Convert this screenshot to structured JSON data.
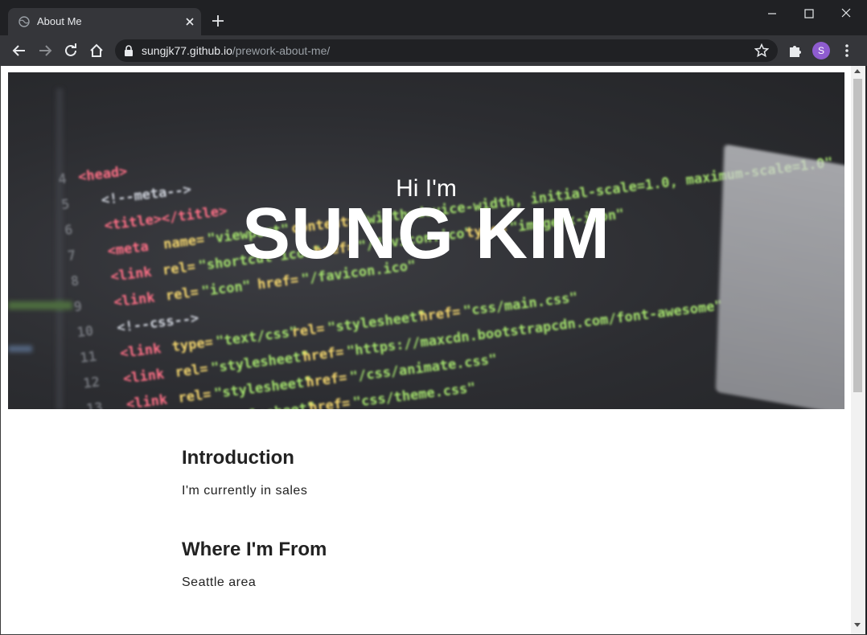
{
  "browser": {
    "tab_title": "About Me",
    "url_host": "sungjk77.github.io",
    "url_path": "/prework-about-me/",
    "profile_initial": "S",
    "profile_color": "#8e5ccf"
  },
  "hero": {
    "subtitle": "Hi I'm",
    "title": "SUNG KIM"
  },
  "sections": [
    {
      "heading": "Introduction",
      "body": "I'm currently in sales"
    },
    {
      "heading": "Where I'm From",
      "body": "Seattle area"
    }
  ]
}
